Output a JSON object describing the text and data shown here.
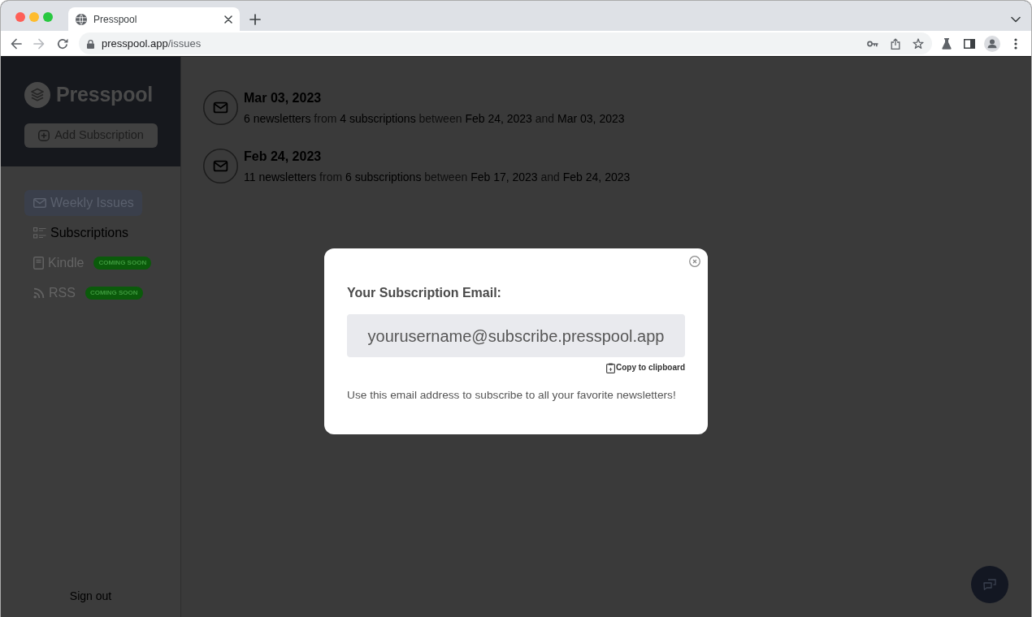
{
  "browser": {
    "tabs": [
      {
        "title": "Presspool",
        "selected": true
      }
    ],
    "address": {
      "host": "presspool.app",
      "path": "/issues"
    }
  },
  "sidebar": {
    "brand": "Presspool",
    "add_button": "Add Subscription",
    "items": [
      {
        "label": "Weekly Issues",
        "selected": true,
        "disabled": false
      },
      {
        "label": "Subscriptions",
        "selected": false,
        "disabled": false
      },
      {
        "label": "Kindle",
        "selected": false,
        "disabled": true,
        "badge": "COMING SOON"
      },
      {
        "label": "RSS",
        "selected": false,
        "disabled": true,
        "badge": "COMING SOON"
      }
    ],
    "sign_out": "Sign out"
  },
  "issues": [
    {
      "title": "Mar 03, 2023",
      "summary": "**6 newsletters** from **4 subscriptions** between **Feb 24, 2023** and **Mar 03, 2023**"
    },
    {
      "title": "Feb 24, 2023",
      "summary": "**11 newsletters** from **6 subscriptions** between **Feb 17, 2023** and **Feb 24, 2023**"
    }
  ],
  "modal": {
    "title": "Your Subscription Email:",
    "email": "yourusername@subscribe.presspool.app",
    "copy_link": "Copy to clipboard",
    "note": "Use this email address to subscribe to all your favorite newsletters!"
  }
}
